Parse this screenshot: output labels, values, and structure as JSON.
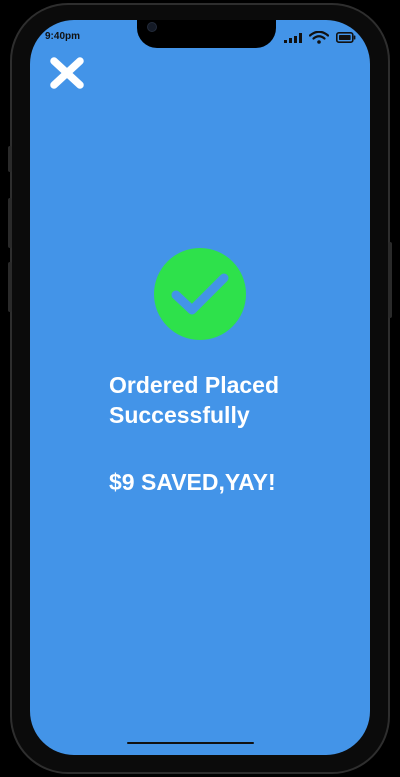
{
  "status_bar": {
    "time": "9:40pm"
  },
  "close_button": {
    "icon": "close-icon"
  },
  "success": {
    "icon": "checkmark-icon",
    "title_line1": "Ordered Placed",
    "title_line2": "Successfully",
    "savings_text": "$9 SAVED,YAY!"
  },
  "colors": {
    "screen_background": "#4394E8",
    "success_green": "#2EE14B",
    "text": "#FFFFFF",
    "checkmark": "#4394E8"
  }
}
